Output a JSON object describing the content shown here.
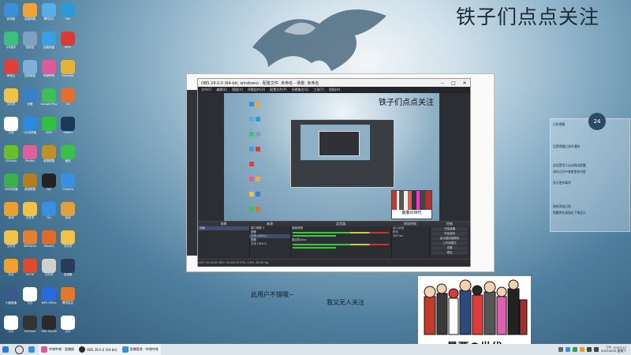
{
  "desktop": {
    "corner_title": "铁子们点点关注",
    "overlay_line1": "此用户不错哦~",
    "overlay_line2": "我又无人关注",
    "manga_title": "最悪の世代",
    "icons": [
      {
        "label": "此电脑",
        "color": "#3a8fd8"
      },
      {
        "label": "百度网盘",
        "color": "#f3a23a"
      },
      {
        "label": "腾讯QQ",
        "color": "#55b0e8"
      },
      {
        "label": "360",
        "color": "#2b9ad6"
      },
      {
        "label": "QQ音乐",
        "color": "#3fbf7f"
      },
      {
        "label": "回收站",
        "color": "#7fa0c0"
      },
      {
        "label": "百度网盘",
        "color": "#3aa0e0"
      },
      {
        "label": "WPS",
        "color": "#d93a3a"
      },
      {
        "label": "网易云",
        "color": "#e0403a"
      },
      {
        "label": "控制面板",
        "color": "#80b0d8"
      },
      {
        "label": "哔哩哔哩",
        "color": "#e05a9a"
      },
      {
        "label": "Rockstar",
        "color": "#e8b23a"
      },
      {
        "label": "文件夹",
        "color": "#f0c24a"
      },
      {
        "label": "设置",
        "color": "#3a80c8"
      },
      {
        "label": "Google Play",
        "color": "#3abf5a"
      },
      {
        "label": "EA",
        "color": "#e07030"
      },
      {
        "label": "文档",
        "color": "#ffffff"
      },
      {
        "label": "QQ浏览器",
        "color": "#2a8ae0"
      },
      {
        "label": "iQIYI",
        "color": "#30c040"
      },
      {
        "label": "Steam",
        "color": "#1a3a5a"
      },
      {
        "label": "GeForce",
        "color": "#6abf2a"
      },
      {
        "label": "Photos",
        "color": "#e0609a"
      },
      {
        "label": "英雄联盟",
        "color": "#c0902a"
      },
      {
        "label": "微信",
        "color": "#3ac04a"
      },
      {
        "label": "360浏览器",
        "color": "#3ab04a"
      },
      {
        "label": "英雄联盟",
        "color": "#b08020"
      },
      {
        "label": "QQ",
        "color": "#222222"
      },
      {
        "label": "Chrome",
        "color": "#3a90e0"
      },
      {
        "label": "游戏",
        "color": "#e8a030"
      },
      {
        "label": "文件夹",
        "color": "#f0c24a"
      },
      {
        "label": "QQ",
        "color": "#3a90e0"
      },
      {
        "label": "游戏",
        "color": "#e0a040"
      },
      {
        "label": "文件夹",
        "color": "#f0c24a"
      },
      {
        "label": "WeGame",
        "color": "#e08030"
      },
      {
        "label": "Garena",
        "color": "#e06a2a"
      },
      {
        "label": "文件夹",
        "color": "#f0c24a"
      },
      {
        "label": "安全",
        "color": "#f0a030"
      },
      {
        "label": "KOOK",
        "color": "#e04a2a"
      },
      {
        "label": "文件夹",
        "color": "#d0d0d0"
      },
      {
        "label": "加速器",
        "color": "#2a3a5a"
      },
      {
        "label": "小鹿直播",
        "color": "#3a5a8a"
      },
      {
        "label": "文件",
        "color": "#ffffff"
      },
      {
        "label": "WPS Office",
        "color": "#2a6ae0"
      },
      {
        "label": "腾讯会议",
        "color": "#e07a2a"
      },
      {
        "label": "文件",
        "color": "#ffffff"
      },
      {
        "label": "GeForce",
        "color": "#333333"
      },
      {
        "label": "OBS Studio",
        "color": "#2a2a2a"
      },
      {
        "label": "文件",
        "color": "#ffffff"
      }
    ]
  },
  "obs": {
    "title": "OBS 29.0.0 (64-bit, windows) - 配置文件: 未命名 - 场景: 未命名",
    "menu": [
      "文件(F)",
      "编辑(E)",
      "视图(V)",
      "停靠部件(D)",
      "配置文件(P)",
      "场景集合(S)",
      "工具(T)",
      "帮助(H)"
    ],
    "preview_title": "铁子们点点关注",
    "docks": {
      "scenes_header": "场景",
      "scene_item": "场景",
      "sources_header": "来源",
      "sources": [
        "窗口捕获 2",
        "图像",
        "文本 (GDI+)",
        "图像",
        "文本 (GDI+)"
      ],
      "mixer_header": "混音器",
      "mixer_tracks": [
        "桌面音频",
        "麦克风/Aux"
      ],
      "transitions_header": "转场特效",
      "transition_value": "淡入淡出",
      "duration_label": "时长",
      "duration_value": "300 ms",
      "controls_header": "控制",
      "controls": [
        "开始直播",
        "开始录制",
        "启动虚拟摄像机",
        "工作室模式",
        "设置",
        "退出"
      ]
    },
    "status": "LIVE: 00:00:00   REC: 00:00:00   CPU: 2.6%, 60.00 fps"
  },
  "widget": {
    "clock": "24",
    "title": "日程提醒",
    "lines": [
      "设置提醒后准时通知",
      "此设置用于自动弹出提醒",
      "请在日历中查看更多内容",
      "显示更多事项",
      "继续添加日程",
      "提醒将在桌面右下角显示"
    ]
  },
  "taskbar": {
    "items": [
      {
        "label": "",
        "color": "#2a7ad8"
      },
      {
        "label": "搜索",
        "color": ""
      },
      {
        "label": "",
        "color": "#3a90e0"
      },
      {
        "label": "哔哩哔哩 - 直播姬",
        "color": "#e05a9a"
      },
      {
        "label": "OBS 29.0.0 (64-bit)",
        "color": "#2a2a2a"
      },
      {
        "label": "直播管理 - 哔哩哔哩",
        "color": "#3a90e0"
      }
    ],
    "time": "下午 10:07:17",
    "date": "2023/4/29 星期六"
  }
}
